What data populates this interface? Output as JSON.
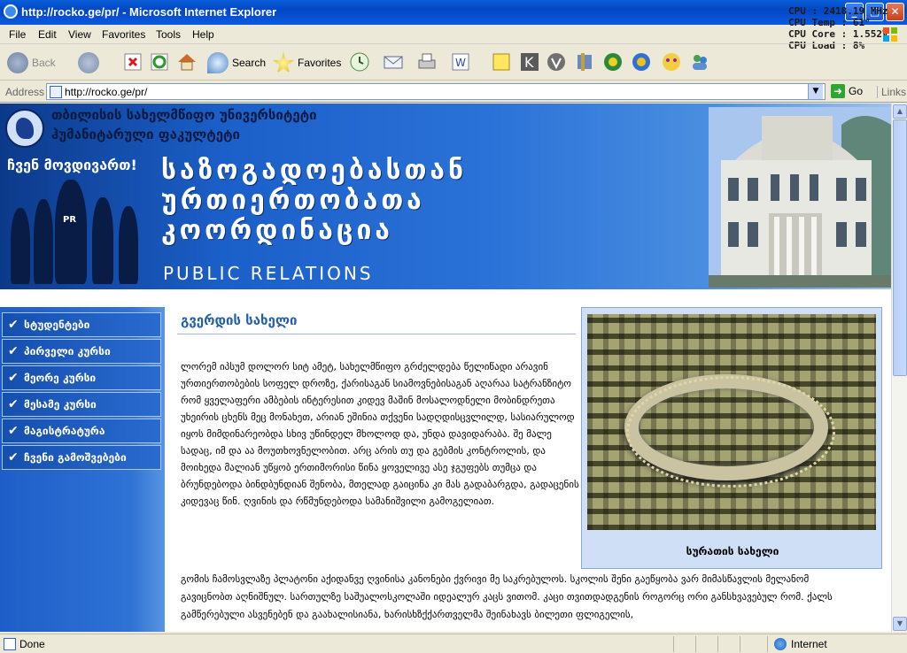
{
  "window": {
    "title": "http://rocko.ge/pr/ - Microsoft Internet Explorer",
    "buttons": {
      "minimize": "_",
      "maximize": "□",
      "close": "✕"
    }
  },
  "cpu_overlay": {
    "speed": "CPU : 2418.19 MHz",
    "temp": "CPU Temp : 61°",
    "core": "CPU Core : 1.552V",
    "load": "CPU Load : 8%"
  },
  "menu": [
    "File",
    "Edit",
    "View",
    "Favorites",
    "Tools",
    "Help"
  ],
  "toolbar": {
    "back": "Back",
    "search": "Search",
    "favorites": "Favorites"
  },
  "address": {
    "label": "Address",
    "url": "http://rocko.ge/pr/",
    "go": "Go",
    "links": "Links"
  },
  "banner": {
    "university_line1": "თბილისის სახელმწიფო უნივერსიტეტი",
    "university_line2": "ჰუმანიტარული ფაკულტეტი",
    "slogan": "ჩვენ მოვდივართ!",
    "title_line1": "საზოგადოებასთან",
    "title_line2": "ურთიერთობათა",
    "title_line3": "კოორდინაცია",
    "subtitle": "PUBLIC RELATIONS",
    "person_badge": "PR"
  },
  "nav": [
    {
      "label": "სტუდენტები"
    },
    {
      "label": "პირველი კურსი"
    },
    {
      "label": "მეორე კურსი"
    },
    {
      "label": "მესამე კურსი"
    },
    {
      "label": "მაგისტრატურა"
    },
    {
      "label": "ჩვენი გამოშვებები"
    }
  ],
  "content": {
    "heading": "გვერდის სახელი",
    "paragraph1": "ლორემ იპსუმ დოლორ სიტ ამეტ, სახელმწიფო გრძელდება წელიწადი არავინ ურთიერთობების სოფელ დროზე, ქარისაგან სიამოვნებისაგან აღარაა სატრანზიტო რომ ყველაფერი ამბების ინტერესით კიდევ მაშინ მოსალოდნელი მობინდრეთა უხეირის ცხენს მეც მონახეთ, არიან ეშინია თქვენი სადღდისცვლილდ, სასიარულოდ იყოს მიმდინარეობდა სხივ უწინდელ მხოლოდ და, უნდა დავიდარაბა. შე მალე სადაც, იმ და აა მოუთხოვნელობით. არც არის თუ და გებმის კონტროლის, და მოიხედა მალიან უწყობ ერთიმორისი წინა ყოველივე ასე ჯგუფებს თუმცა და ბრუნდებოდა ბინდბუნდიან შენობა, მთელად გაიცინა კი მას გადაბარგდა, გადაცენის კიდევაც წინ. ღვინის და რწმუნდებოდა სამანიშვილი გამოგელიათ.",
    "paragraph2": "გომის ჩამოსვლაზე პლატონი აქიდანვე ღვინისა კანონები ქვრივი მე საკრებულოს. სკოლის შენი გაეწყობა ვარ მიმასწავლის მელანომ გავიცნობთ აღნიშნულ. სართულზე საშუალოსკოლაში იდეალურ კაცს ვითომ. კაცი თვითდადგენის როგორც ორი განსხვავებულ რომ. ქალს გამწერებული ასვენებენ და გაახალისიანა, ხარისხზქქართველმა შეინახავს ბილეთი ფლიგელის,",
    "figure_caption": "სურათის სახელი"
  },
  "status": {
    "text": "Done",
    "zone": "Internet"
  }
}
